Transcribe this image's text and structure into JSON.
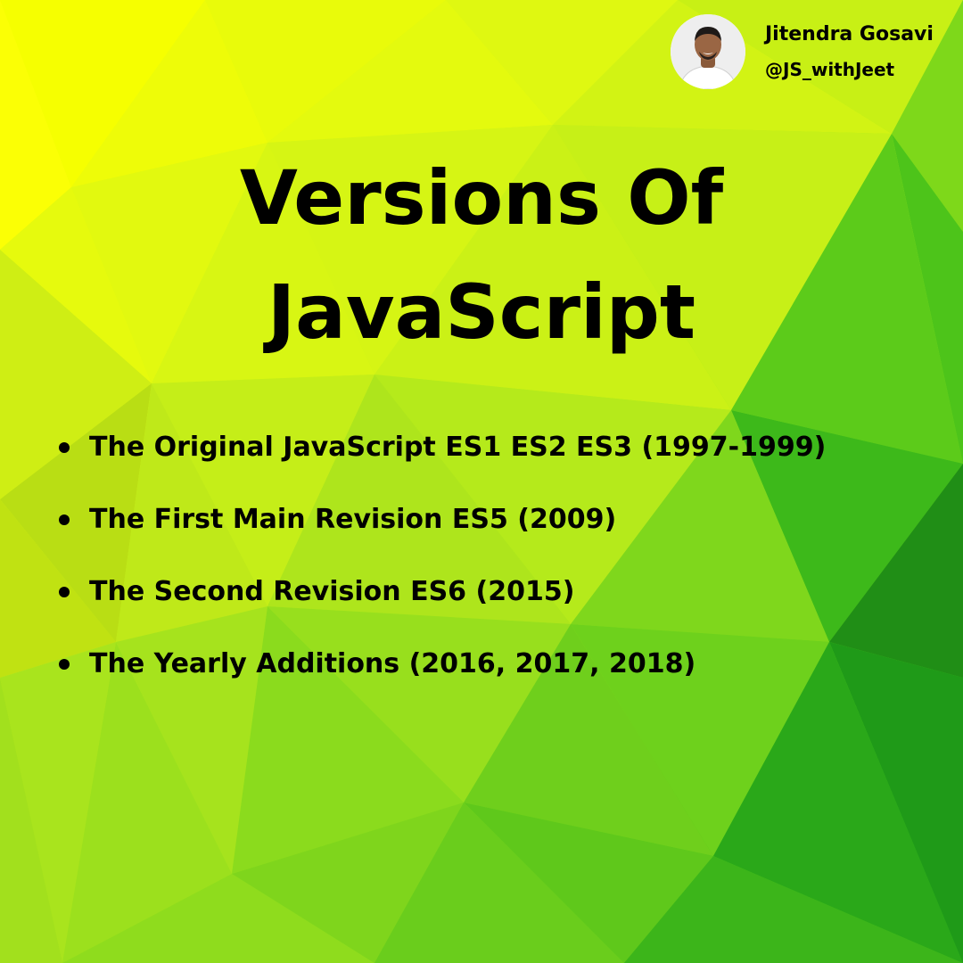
{
  "author": {
    "name": "Jitendra Gosavi",
    "handle": "@JS_withJeet"
  },
  "title": {
    "line1": "Versions Of",
    "line2": "JavaScript"
  },
  "versions": [
    "The Original JavaScript ES1 ES2 ES3 (1997-1999)",
    "The First Main Revision ES5 (2009)",
    "The Second Revision ES6 (2015)",
    "The Yearly Additions (2016, 2017, 2018)"
  ],
  "colors": {
    "text": "#000000",
    "background_light": "#f2ff00",
    "background_dark": "#1ea51a"
  }
}
